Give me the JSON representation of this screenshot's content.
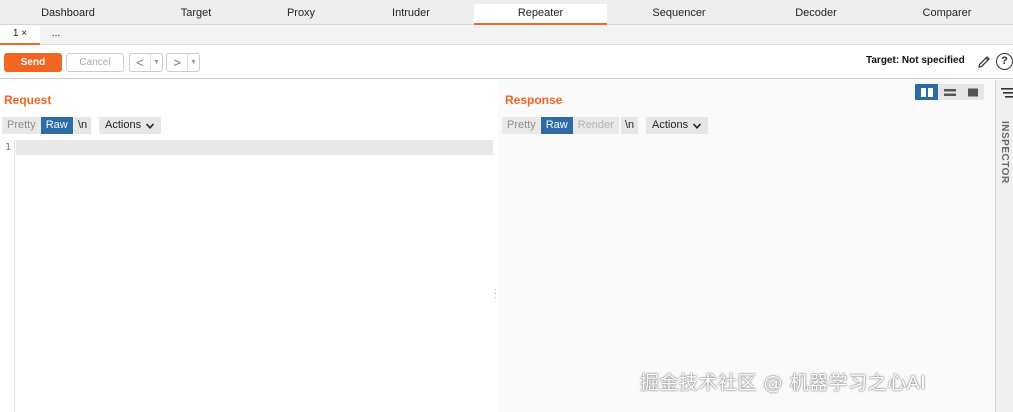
{
  "top_tabs": [
    "Dashboard",
    "Target",
    "Proxy",
    "Intruder",
    "Repeater",
    "Sequencer",
    "Decoder",
    "Comparer"
  ],
  "active_top_tab": "Repeater",
  "sub_tabs": {
    "first": "1 ×",
    "more": "..."
  },
  "toolbar": {
    "send_label": "Send",
    "cancel_label": "Cancel",
    "back_arrow": "<",
    "forward_arrow": ">",
    "dropdown_glyph": "▼",
    "target_label": "Target: Not specified",
    "help_glyph": "?"
  },
  "request": {
    "title": "Request",
    "view_options": [
      "Pretty",
      "Raw"
    ],
    "selected_view": "Raw",
    "newline_toggle": "\\n",
    "actions_label": "Actions",
    "line_numbers": [
      "1"
    ]
  },
  "response": {
    "title": "Response",
    "view_options": [
      "Pretty",
      "Raw",
      "Render"
    ],
    "selected_view": "Raw",
    "newline_toggle": "\\n",
    "actions_label": "Actions"
  },
  "inspector": {
    "label": "INSPECTOR"
  },
  "watermark": "掘金技术社区 @ 机器学习之心AI",
  "colors": {
    "accent": "#f26522",
    "selected": "#2c6aa8"
  },
  "icons": [
    "pencil-icon",
    "help-icon",
    "chevron-down-icon",
    "layout-split-icon",
    "layout-rows-icon",
    "layout-single-icon",
    "inspector-menu-icon"
  ]
}
